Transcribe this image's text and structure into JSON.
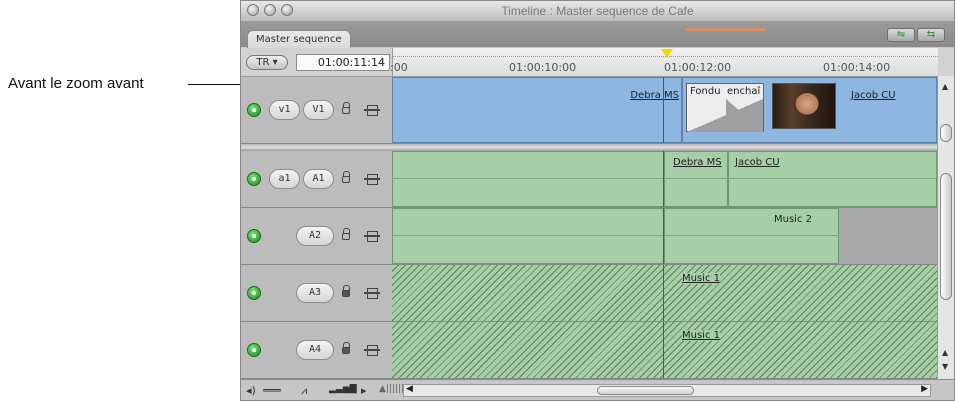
{
  "callout": {
    "text": "Avant le zoom avant"
  },
  "window": {
    "title": "Timeline : Master sequence de Cafe"
  },
  "tab": {
    "label": "Master sequence"
  },
  "ruler": {
    "tr_button": "TR ▾",
    "timecode": "01:00:11:14",
    "labels": [
      ":00",
      "01:00:10:00",
      "01:00:12:00",
      "01:00:14:00"
    ]
  },
  "tracks": {
    "v1": {
      "source": "v1",
      "dest": "V1"
    },
    "a1": {
      "source": "a1",
      "dest": "A1"
    },
    "a2": {
      "dest": "A2"
    },
    "a3": {
      "dest": "A3"
    },
    "a4": {
      "dest": "A4"
    }
  },
  "clips": {
    "v1_debra": "Debra MS",
    "v1_fondu_a": "Fondu",
    "v1_fondu_b": "enchaî",
    "v1_jacob": "Jacob CU",
    "a1_debra": "Debra MS",
    "a1_jacob": "Jacob CU",
    "a2_music": "Music 2",
    "a3_music": "Music 1",
    "a4_music": "Music 1"
  },
  "colors": {
    "video_clip": "#8db7e0",
    "audio_clip": "#a6cfa8",
    "playhead": "#f0d800"
  },
  "icons": [
    "close-icon",
    "minimize-icon",
    "zoom-icon",
    "track-visibility-icon",
    "lock-icon",
    "link-icon",
    "clip-overlay-icon",
    "keyframe-icon",
    "zoom-slider-icon",
    "scroll-arrow-icon"
  ]
}
